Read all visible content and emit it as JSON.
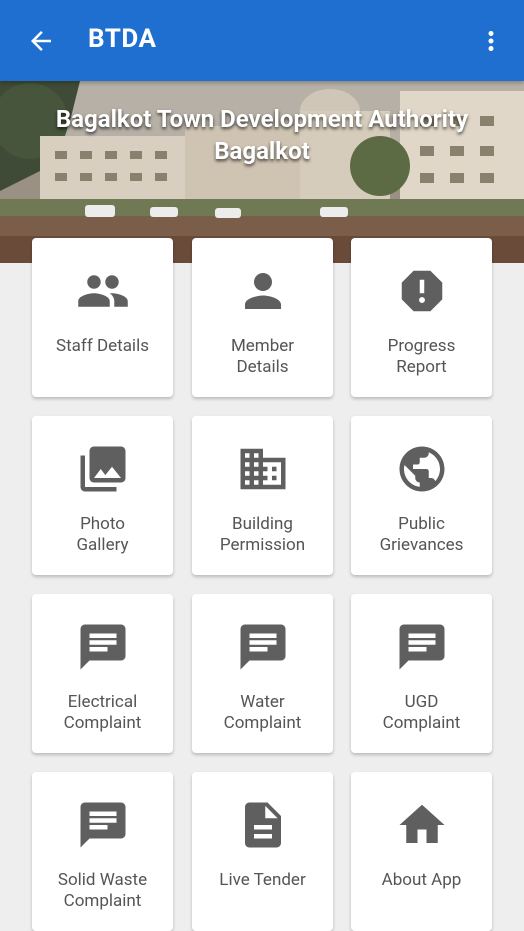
{
  "appbar": {
    "title": "BTDA",
    "back_icon": "arrow-back-icon",
    "menu_icon": "more-vert-icon"
  },
  "banner": {
    "line1": "Bagalkot Town Development Authority",
    "line2": "Bagalkot"
  },
  "tiles": [
    {
      "label": "Staff Details",
      "icon": "people-icon"
    },
    {
      "label": "Member Details",
      "icon": "person-icon"
    },
    {
      "label": "Progress Report",
      "icon": "alert-octagon-icon"
    },
    {
      "label": "Photo Gallery",
      "icon": "photo-library-icon"
    },
    {
      "label": "Building Permission",
      "icon": "building-icon"
    },
    {
      "label": "Public Grievances",
      "icon": "globe-icon"
    },
    {
      "label": "Electrical Complaint",
      "icon": "message-icon"
    },
    {
      "label": "Water Complaint",
      "icon": "message-icon"
    },
    {
      "label": "UGD Complaint",
      "icon": "message-icon"
    },
    {
      "label": "Solid Waste Complaint",
      "icon": "message-icon"
    },
    {
      "label": "Live Tender",
      "icon": "document-icon"
    },
    {
      "label": "About App",
      "icon": "home-icon"
    }
  ],
  "colors": {
    "primary": "#1e6fcf",
    "icon": "#5f5f5f",
    "background": "#eeeeee"
  }
}
